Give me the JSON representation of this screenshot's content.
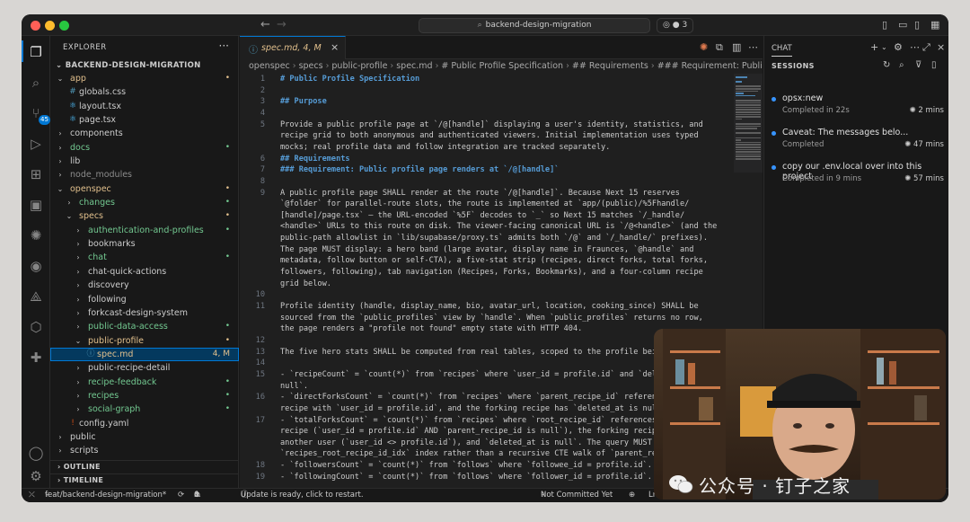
{
  "titlebar": {
    "search": "backend-design-migration",
    "agent_count": "3"
  },
  "activity": {
    "scm_badge": "45"
  },
  "explorer": {
    "title": "EXPLORER",
    "root": "BACKEND-DESIGN-MIGRATION",
    "items": [
      {
        "label": "app",
        "kind": "folder-open",
        "depth": 0,
        "color": "orange",
        "dot": true
      },
      {
        "label": "globals.css",
        "kind": "css",
        "depth": 1
      },
      {
        "label": "layout.tsx",
        "kind": "tsx",
        "depth": 1
      },
      {
        "label": "page.tsx",
        "kind": "tsx",
        "depth": 1
      },
      {
        "label": "components",
        "kind": "folder",
        "depth": 0
      },
      {
        "label": "docs",
        "kind": "folder",
        "depth": 0,
        "color": "green",
        "dot": true
      },
      {
        "label": "lib",
        "kind": "folder",
        "depth": 0
      },
      {
        "label": "node_modules",
        "kind": "folder",
        "depth": 0,
        "color": "dim"
      },
      {
        "label": "openspec",
        "kind": "folder-open",
        "depth": 0,
        "color": "orange",
        "dot": true
      },
      {
        "label": "changes",
        "kind": "folder",
        "depth": 1,
        "color": "green",
        "dot": true
      },
      {
        "label": "specs",
        "kind": "folder-open",
        "depth": 1,
        "color": "orange",
        "dot": true
      },
      {
        "label": "authentication-and-profiles",
        "kind": "folder",
        "depth": 2,
        "color": "green",
        "dot": true
      },
      {
        "label": "bookmarks",
        "kind": "folder",
        "depth": 2
      },
      {
        "label": "chat",
        "kind": "folder",
        "depth": 2,
        "color": "green",
        "dot": true
      },
      {
        "label": "chat-quick-actions",
        "kind": "folder",
        "depth": 2
      },
      {
        "label": "discovery",
        "kind": "folder",
        "depth": 2
      },
      {
        "label": "following",
        "kind": "folder",
        "depth": 2
      },
      {
        "label": "forkcast-design-system",
        "kind": "folder",
        "depth": 2
      },
      {
        "label": "public-data-access",
        "kind": "folder",
        "depth": 2,
        "color": "green",
        "dot": true
      },
      {
        "label": "public-profile",
        "kind": "folder-open",
        "depth": 2,
        "color": "orange",
        "dot": true
      },
      {
        "label": "spec.md",
        "kind": "md",
        "depth": 3,
        "color": "orange",
        "status": "4, M",
        "selected": true
      },
      {
        "label": "public-recipe-detail",
        "kind": "folder",
        "depth": 2
      },
      {
        "label": "recipe-feedback",
        "kind": "folder",
        "depth": 2,
        "color": "green",
        "dot": true
      },
      {
        "label": "recipes",
        "kind": "folder",
        "depth": 2,
        "color": "green",
        "dot": true
      },
      {
        "label": "social-graph",
        "kind": "folder",
        "depth": 2,
        "color": "green",
        "dot": true
      },
      {
        "label": "config.yaml",
        "kind": "yaml",
        "depth": 1
      },
      {
        "label": "public",
        "kind": "folder",
        "depth": 0
      },
      {
        "label": "scripts",
        "kind": "folder",
        "depth": 0
      }
    ],
    "outline": "OUTLINE",
    "timeline": "TIMELINE"
  },
  "editor": {
    "tab": {
      "label": "spec.md",
      "status": "4, M"
    },
    "breadcrumbs": [
      "openspec",
      "specs",
      "public-profile",
      "spec.md",
      "# Public Profile Specification",
      "## Requirements",
      "### Requirement: Public profile page renders at `/@[handle]`"
    ],
    "lines": [
      {
        "n": "1",
        "t": "# Public Profile Specification",
        "h": true
      },
      {
        "n": "2",
        "t": ""
      },
      {
        "n": "3",
        "t": "## Purpose",
        "h": true
      },
      {
        "n": "4",
        "t": ""
      },
      {
        "n": "5",
        "t": "Provide a public profile page at `/@[handle]` displaying a user's identity, statistics, and"
      },
      {
        "n": "",
        "t": "recipe grid to both anonymous and authenticated viewers. Initial implementation uses typed"
      },
      {
        "n": "",
        "t": "mocks; real profile data and follow integration are tracked separately."
      },
      {
        "n": "6",
        "t": "## Requirements",
        "h": true
      },
      {
        "n": "7",
        "t": "### Requirement: Public profile page renders at `/@[handle]`",
        "h": true
      },
      {
        "n": "8",
        "t": ""
      },
      {
        "n": "9",
        "t": "A public profile page SHALL render at the route `/@[handle]`. Because Next 15 reserves"
      },
      {
        "n": "",
        "t": "`@folder` for parallel-route slots, the route is implemented at `app/(public)/%5Fhandle/"
      },
      {
        "n": "",
        "t": "[handle]/page.tsx` — the URL-encoded `%5F` decodes to `_` so Next 15 matches `/_handle/"
      },
      {
        "n": "",
        "t": "<handle>` URLs to this route on disk. The viewer-facing canonical URL is `/@<handle>` (and the"
      },
      {
        "n": "",
        "t": "public-path allowlist in `lib/supabase/proxy.ts` admits both `/@` and `/_handle/` prefixes)."
      },
      {
        "n": "",
        "t": "The page MUST display: a hero band (large avatar, display name in Fraunces, `@handle` and"
      },
      {
        "n": "",
        "t": "metadata, follow button or self-CTA), a five-stat strip (recipes, direct forks, total forks,"
      },
      {
        "n": "",
        "t": "followers, following), tab navigation (Recipes, Forks, Bookmarks), and a four-column recipe"
      },
      {
        "n": "",
        "t": "grid below."
      },
      {
        "n": "10",
        "t": ""
      },
      {
        "n": "11",
        "t": "Profile identity (handle, display_name, bio, avatar_url, location, cooking_since) SHALL be"
      },
      {
        "n": "",
        "t": "sourced from the `public_profiles` view by `handle`. When `public_profiles` returns no row,"
      },
      {
        "n": "",
        "t": "the page renders a \"profile not found\" empty state with HTTP 404."
      },
      {
        "n": "12",
        "t": ""
      },
      {
        "n": "13",
        "t": "The five hero stats SHALL be computed from real tables, scoped to the profile being"
      },
      {
        "n": "14",
        "t": ""
      },
      {
        "n": "15",
        "t": "- `recipeCount` = `count(*)` from `recipes` where `user_id = profile.id` and `deleted_at is"
      },
      {
        "n": "",
        "t": "null`."
      },
      {
        "n": "16",
        "t": "- `directForksCount` = `count(*)` from `recipes` where `parent_recipe_id` references a"
      },
      {
        "n": "",
        "t": "recipe with `user_id = profile.id`, and the forking recipe has `deleted_at is null`."
      },
      {
        "n": "17",
        "t": "- `totalForksCount` = `count(*)` from `recipes` where `root_recipe_id` references a root"
      },
      {
        "n": "",
        "t": "recipe (`user_id = profile.id` AND `parent_recipe_id is null`), the forking recipe is by"
      },
      {
        "n": "",
        "t": "another user (`user_id <> profile.id`), and `deleted_at is null`. The query MUST use the"
      },
      {
        "n": "",
        "t": "`recipes_root_recipe_id_idx` index rather than a recursive CTE walk of `parent_recipe_id`."
      },
      {
        "n": "18",
        "t": "- `followersCount` = `count(*)` from `follows` where `followee_id = profile.id`."
      },
      {
        "n": "19",
        "t": "- `followingCount` = `count(*)` from `follows` where `follower_id = profile.id`."
      }
    ]
  },
  "chat": {
    "tab": "CHAT",
    "sessions_title": "SESSIONS",
    "sessions": [
      {
        "title": "opsx:new",
        "status": "Completed in 22s",
        "age": "2 mins"
      },
      {
        "title": "Caveat: The messages belo...",
        "status": "Completed",
        "age": "47 mins"
      },
      {
        "title": "copy our .env.local over into this project",
        "status": "Completed in 9 mins",
        "age": "57 mins"
      }
    ]
  },
  "status": {
    "branch": "feat/backend-design-migration*",
    "errors": "0",
    "warnings": "4",
    "update": "Update is ready, click to restart.",
    "commit": "Not Committed Yet",
    "position": "Ln 79, Col 1"
  },
  "watermark": "公众号 · 钉子之家",
  "colors": {
    "accent": "#0078d4",
    "modified": "#e2c08d",
    "added": "#73c991",
    "heading": "#569cd6"
  }
}
